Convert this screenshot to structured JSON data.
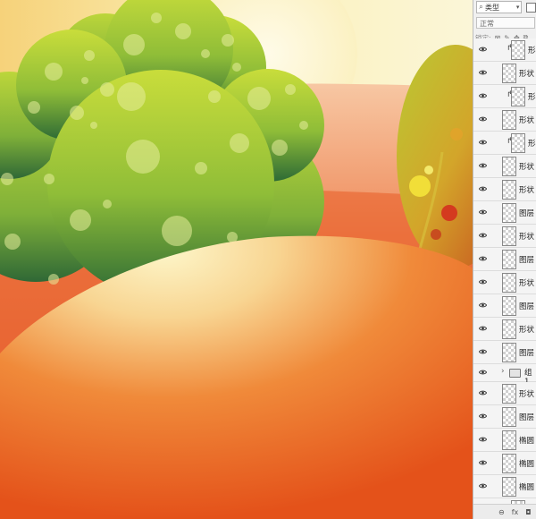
{
  "colors": {
    "panel_bg": "#f0f0f0",
    "hill_orange": "#e9621c",
    "hill_cream": "#fbf3c4",
    "tree_green_light": "#c3d93a",
    "tree_green_dark": "#2e6a35"
  },
  "layers_panel": {
    "filter_icon": "search-icon",
    "filter_label": "类型",
    "blend_mode": "正常",
    "lock_label": "锁定:",
    "lock_icons": [
      "⊠",
      "✎",
      "✥",
      "⧉"
    ],
    "bottom_icons": [
      "⊖",
      "fx",
      "◘"
    ],
    "layers": [
      {
        "name": "形状",
        "indent": true,
        "type": "layer"
      },
      {
        "name": "形状",
        "indent": false,
        "type": "layer"
      },
      {
        "name": "形状",
        "indent": true,
        "type": "layer"
      },
      {
        "name": "形状",
        "indent": false,
        "type": "layer"
      },
      {
        "name": "形状",
        "indent": true,
        "type": "layer"
      },
      {
        "name": "形状",
        "indent": false,
        "type": "layer"
      },
      {
        "name": "形状",
        "indent": false,
        "type": "layer"
      },
      {
        "name": "图层",
        "indent": false,
        "type": "layer"
      },
      {
        "name": "形状",
        "indent": false,
        "type": "layer"
      },
      {
        "name": "图层",
        "indent": false,
        "type": "layer"
      },
      {
        "name": "形状",
        "indent": false,
        "type": "layer"
      },
      {
        "name": "图层",
        "indent": false,
        "type": "layer"
      },
      {
        "name": "形状",
        "indent": false,
        "type": "layer"
      },
      {
        "name": "图层",
        "indent": false,
        "type": "layer"
      },
      {
        "name": "组 1",
        "indent": false,
        "type": "group"
      },
      {
        "name": "形状",
        "indent": false,
        "type": "layer"
      },
      {
        "name": "图层",
        "indent": false,
        "type": "layer"
      },
      {
        "name": "椭圆",
        "indent": false,
        "type": "layer"
      },
      {
        "name": "椭圆",
        "indent": false,
        "type": "layer"
      },
      {
        "name": "椭圆",
        "indent": false,
        "type": "layer"
      },
      {
        "name": "形状",
        "indent": true,
        "type": "layer"
      },
      {
        "name": "形状",
        "indent": false,
        "type": "layer"
      }
    ]
  }
}
